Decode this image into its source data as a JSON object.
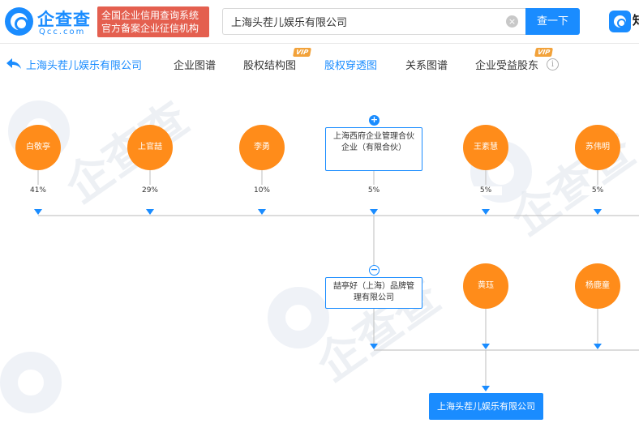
{
  "header": {
    "logo_name": "企查查",
    "logo_domain": "Qcc.com",
    "cert_line1": "全国企业信用查询系统",
    "cert_line2": "官方备案企业征信机构",
    "search_value": "上海头茬儿娱乐有限公司",
    "search_button": "查一下",
    "app_text": "知"
  },
  "nav": {
    "company": "上海头茬儿娱乐有限公司",
    "tabs": [
      {
        "label": "企业图谱"
      },
      {
        "label": "股权结构图",
        "vip": "VIP"
      },
      {
        "label": "股权穿透图"
      },
      {
        "label": "关系图谱"
      },
      {
        "label": "企业受益股东",
        "vip": "VIP"
      }
    ],
    "info": "i"
  },
  "graph": {
    "shareholders": [
      {
        "name": "白敬亭",
        "percent": "41%"
      },
      {
        "name": "上官喆",
        "percent": "29%"
      },
      {
        "name": "李勇",
        "percent": "10%"
      },
      {
        "name": "上海西府企业管理合伙企业（有限合伙）",
        "percent": "5%",
        "expand": "+"
      },
      {
        "name": "王紊慧",
        "percent": "5%"
      },
      {
        "name": "苏伟明",
        "percent": "5%"
      }
    ],
    "second_tier": [
      {
        "name": "喆亭好（上海）品牌管理有限公司",
        "collapse": "−"
      },
      {
        "name": "黄珏"
      },
      {
        "name": "杨鹿童"
      }
    ],
    "target": "上海头茬儿娱乐有限公司"
  },
  "watermark": {
    "text": "企查查",
    "domain": "Qcc.com"
  },
  "colors": {
    "brand": "#1a8cff",
    "person_node": "#ff8c1a",
    "cert_badge": "#e45f4f",
    "vip": "#f2a23a"
  }
}
